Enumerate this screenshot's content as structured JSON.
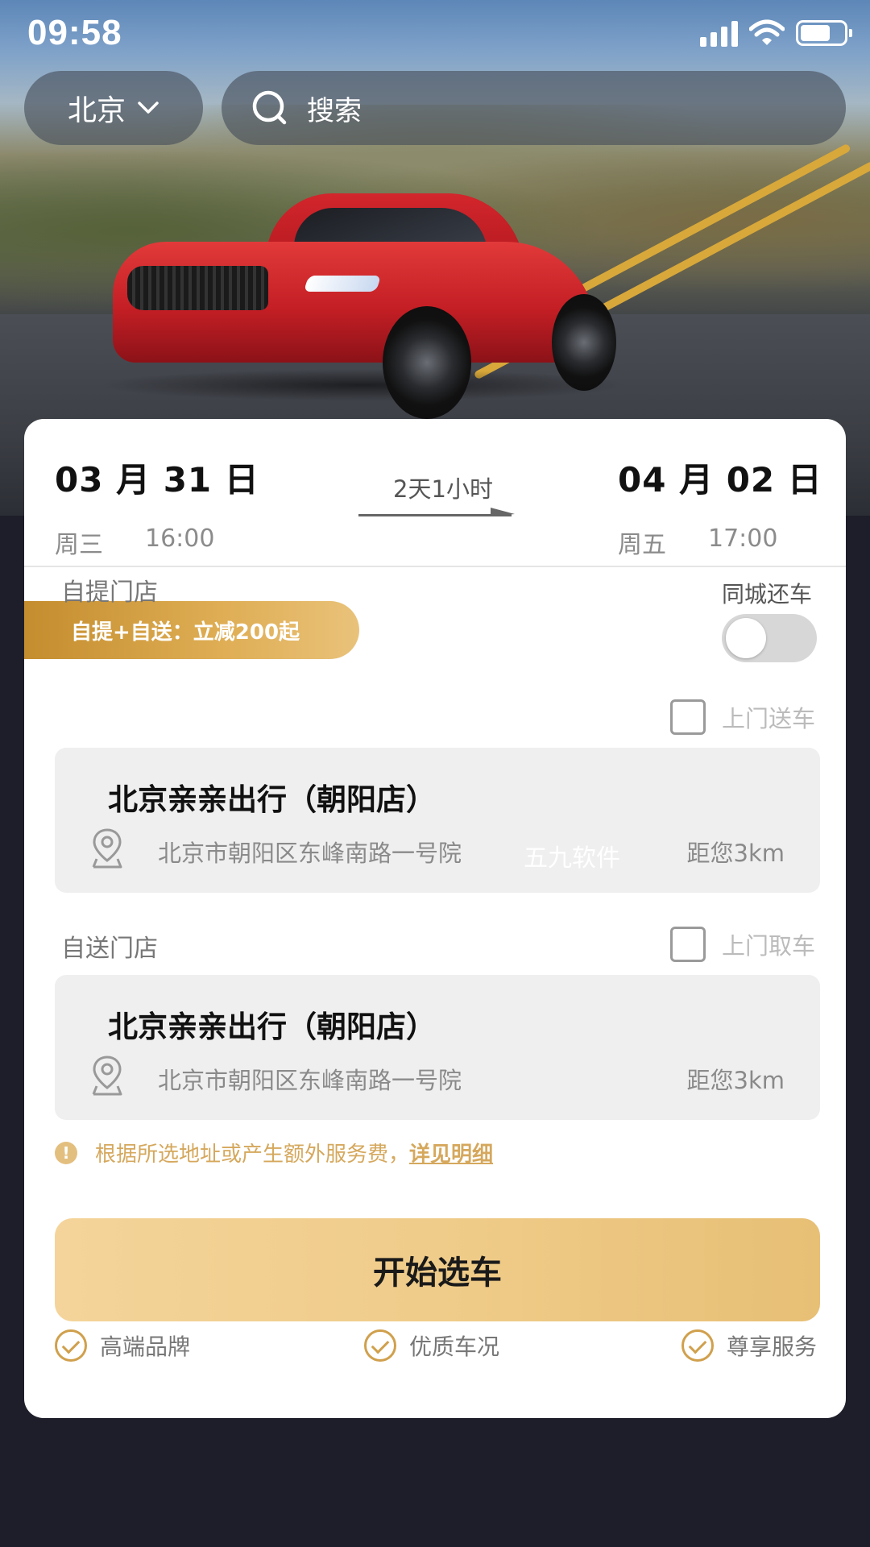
{
  "status_bar": {
    "time": "09:58"
  },
  "header": {
    "city": "北京",
    "search_placeholder": "搜索"
  },
  "hero": {
    "image": "red-sports-car-on-road"
  },
  "rental": {
    "start": {
      "date": "03 月 31 日",
      "weekday": "周三",
      "time": "16:00"
    },
    "end": {
      "date": "04 月 02 日",
      "weekday": "周五",
      "time": "17:00"
    },
    "duration": "2天1小时"
  },
  "promo": {
    "text": "自提+自送：立减200起"
  },
  "same_city_return": {
    "label": "同城还车",
    "enabled": false
  },
  "pickup": {
    "section_label": "自提门店",
    "option_label": "上门送车",
    "option_checked": false,
    "store_name": "北京亲亲出行（朝阳店）",
    "address": "北京市朝阳区东峰南路一号院",
    "distance": "距您3km",
    "watermark": "五九软件"
  },
  "dropoff": {
    "section_label": "自送门店",
    "option_label": "上门取车",
    "option_checked": false,
    "store_name": "北京亲亲出行（朝阳店）",
    "address": "北京市朝阳区东峰南路一号院",
    "distance": "距您3km"
  },
  "notice": {
    "icon_text": "!",
    "text": "根据所选地址或产生额外服务费，",
    "link": "详见明细"
  },
  "start_button": {
    "label": "开始选车"
  },
  "features": [
    {
      "label": "高端品牌"
    },
    {
      "label": "优质车况"
    },
    {
      "label": "尊享服务"
    }
  ],
  "colors": {
    "accent_gold": "#D0A04D",
    "button_gold": "#EFCB88",
    "background_dark": "#1E1E2A"
  }
}
